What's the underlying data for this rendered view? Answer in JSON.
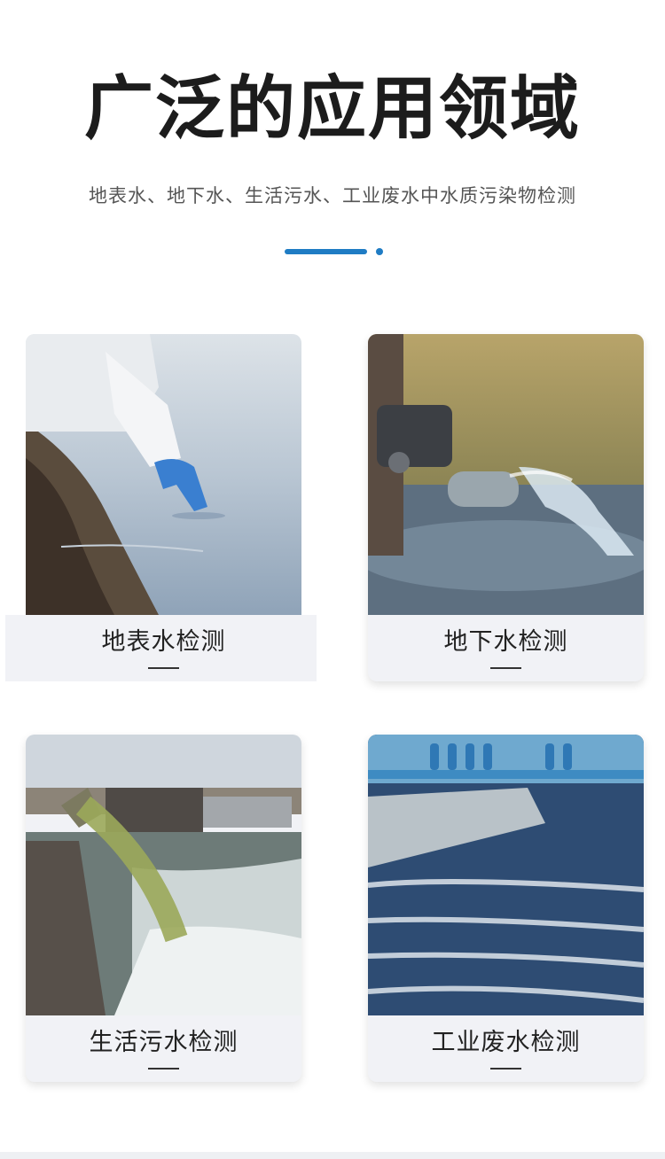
{
  "header": {
    "title": "广泛的应用领域",
    "subtitle": "地表水、地下水、生活污水、工业废水中水质污染物检测"
  },
  "cards": [
    {
      "label": "地表水检测",
      "icon": "surface-water-sampling-photo"
    },
    {
      "label": "地下水检测",
      "icon": "groundwater-pipe-photo"
    },
    {
      "label": "生活污水检测",
      "icon": "domestic-sewage-outfall-photo"
    },
    {
      "label": "工业废水检测",
      "icon": "industrial-wastewater-tank-photo"
    }
  ],
  "colors": {
    "accent": "#1f7cc4",
    "card_bg": "#f1f2f6",
    "title": "#1c1c1c"
  }
}
